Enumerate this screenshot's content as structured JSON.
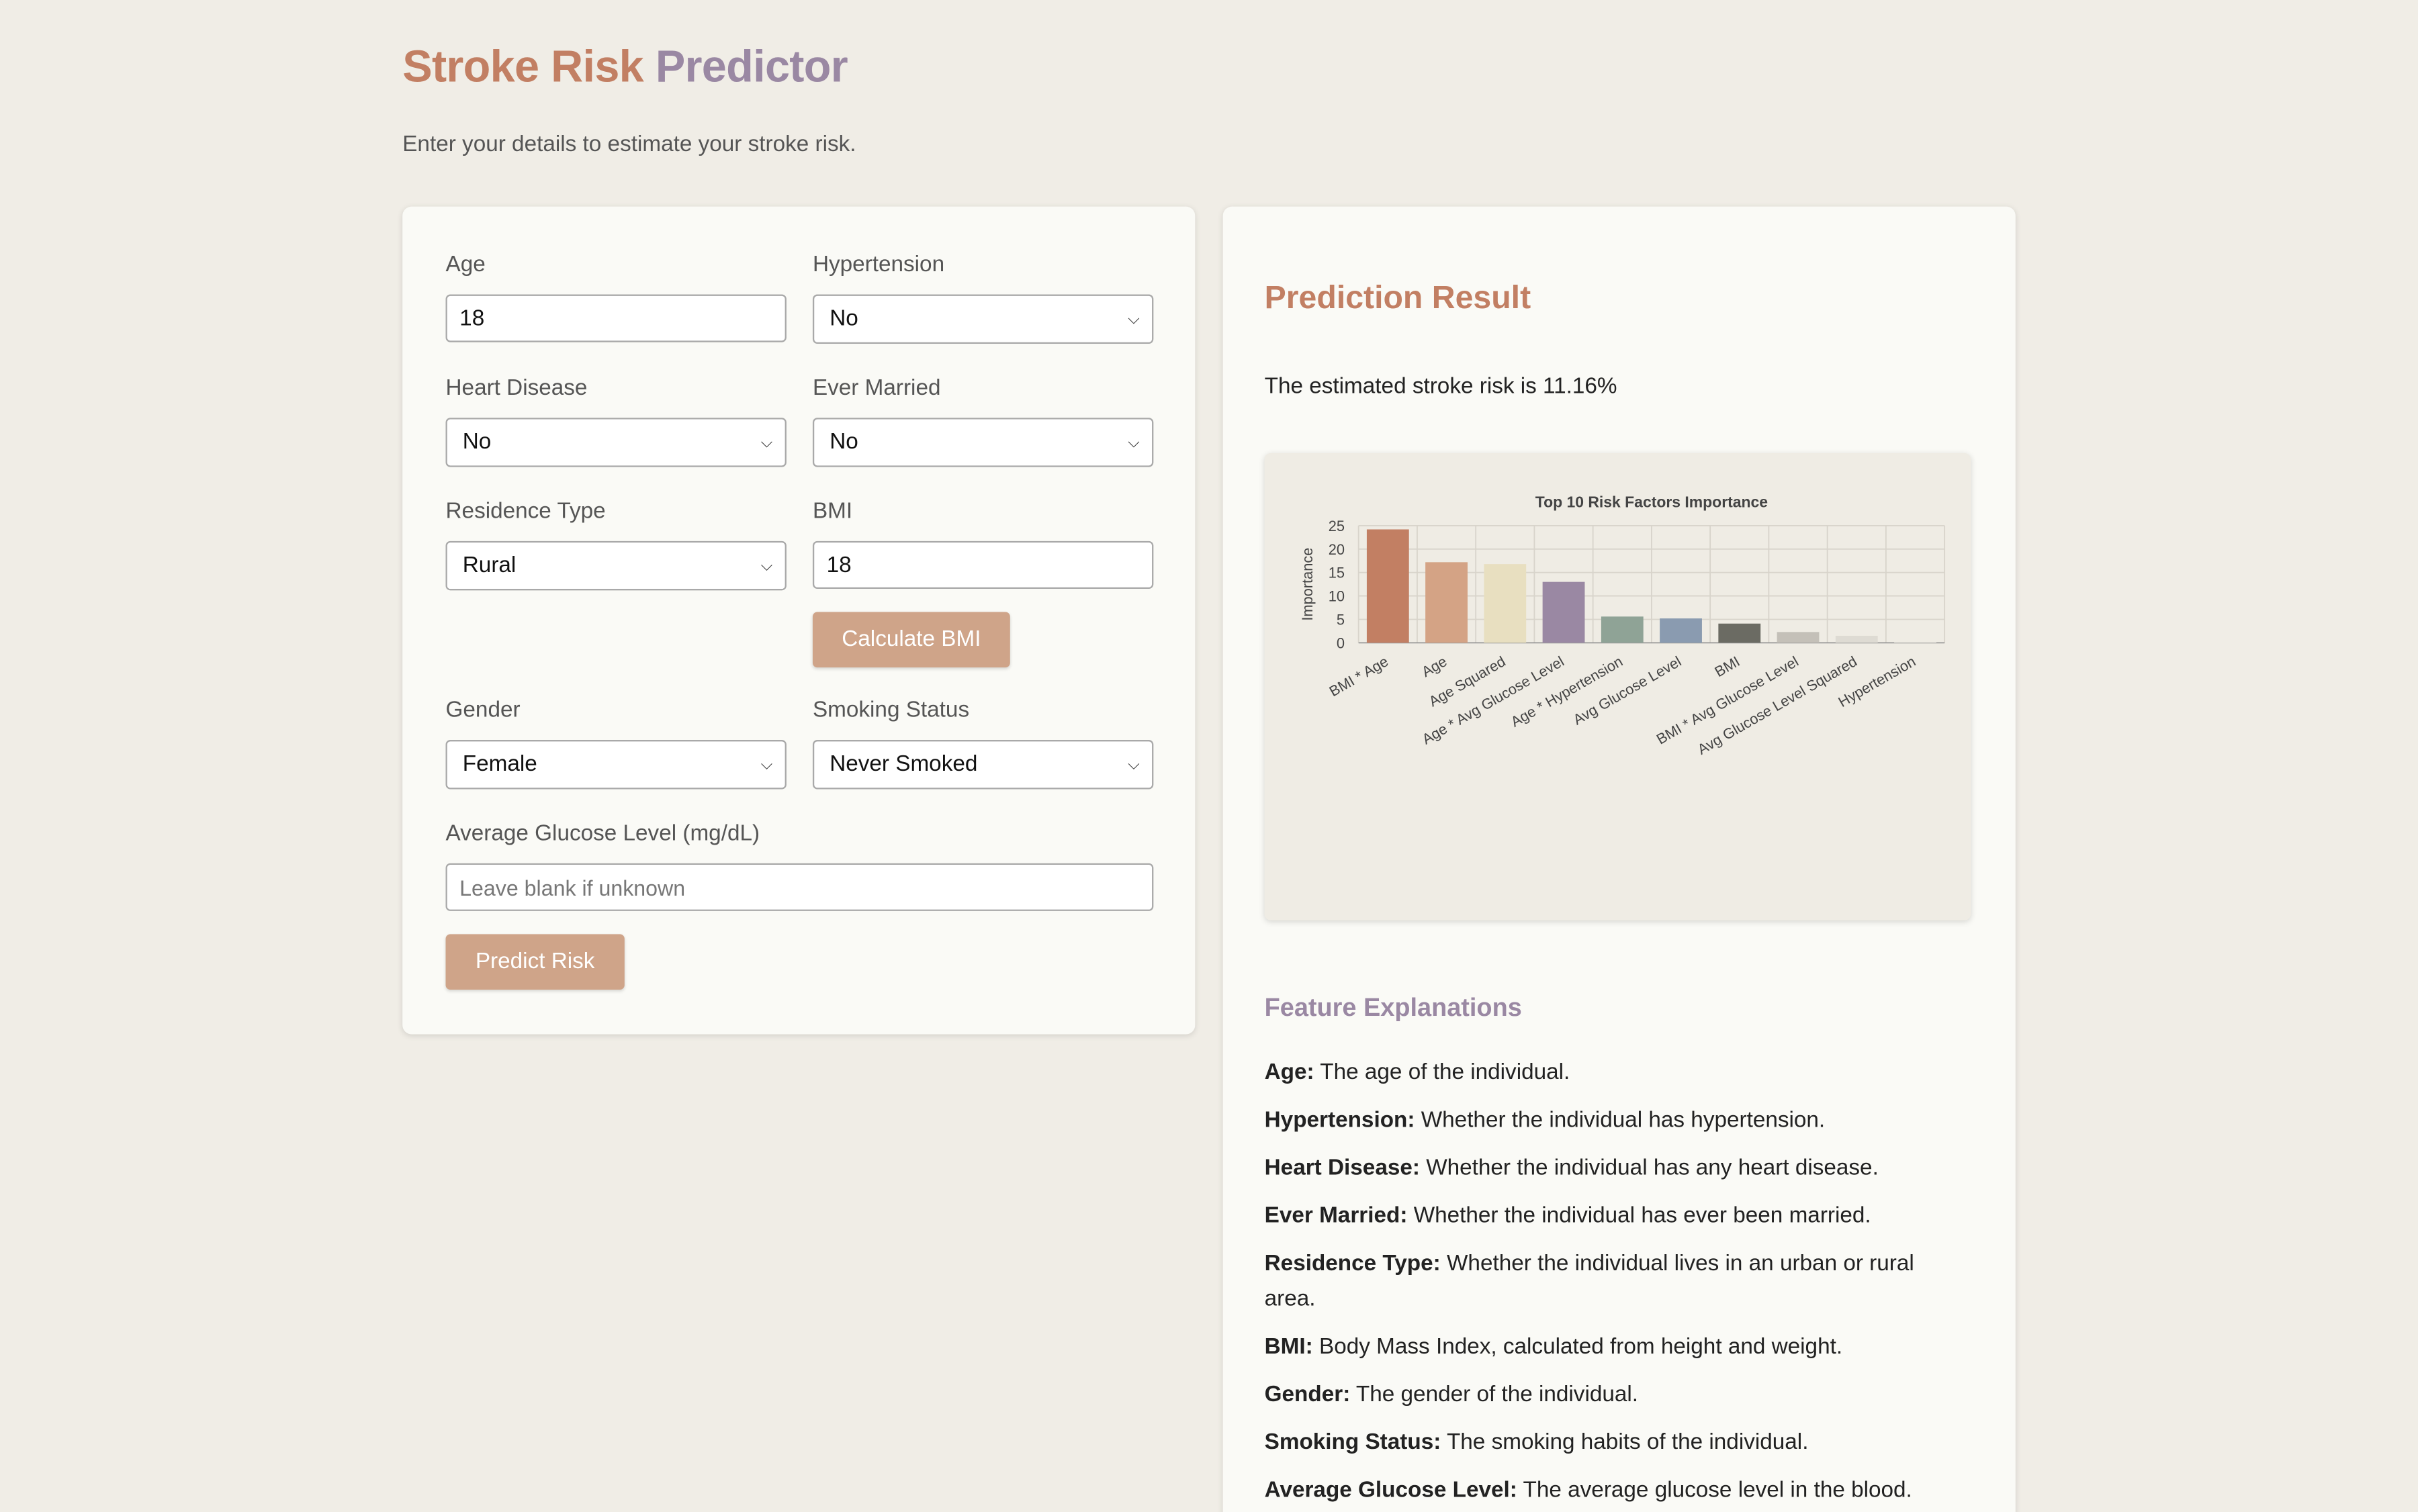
{
  "header": {
    "title_part1": "Stroke Risk",
    "title_part2": "Predictor",
    "subtitle": "Enter your details to estimate your stroke risk."
  },
  "form": {
    "age": {
      "label": "Age",
      "value": "18"
    },
    "hypertension": {
      "label": "Hypertension",
      "value": "No"
    },
    "heart_disease": {
      "label": "Heart Disease",
      "value": "No"
    },
    "ever_married": {
      "label": "Ever Married",
      "value": "No"
    },
    "residence_type": {
      "label": "Residence Type",
      "value": "Rural"
    },
    "bmi": {
      "label": "BMI",
      "value": "18"
    },
    "calculate_bmi_label": "Calculate BMI",
    "gender": {
      "label": "Gender",
      "value": "Female"
    },
    "smoking_status": {
      "label": "Smoking Status",
      "value": "Never Smoked"
    },
    "glucose": {
      "label": "Average Glucose Level (mg/dL)",
      "placeholder": "Leave blank if unknown"
    },
    "predict_label": "Predict Risk"
  },
  "result": {
    "title": "Prediction Result",
    "text": "The estimated stroke risk is 11.16%"
  },
  "chart_data": {
    "type": "bar",
    "title": "Top 10 Risk Factors Importance",
    "xlabel": "",
    "ylabel": "Importance",
    "ylim": [
      0,
      25
    ],
    "yticks": [
      0,
      5,
      10,
      15,
      20,
      25
    ],
    "grid": true,
    "categories": [
      "BMI * Age",
      "Age",
      "Age Squared",
      "Age * Avg Glucose Level",
      "Age * Hypertension",
      "Avg Glucose Level",
      "BMI",
      "BMI * Avg Glucose Level",
      "Avg Glucose Level Squared",
      "Hypertension"
    ],
    "values": [
      24.2,
      17.2,
      16.8,
      13.0,
      5.6,
      5.2,
      4.1,
      2.3,
      1.5,
      0.2
    ],
    "colors": [
      "#c27f63",
      "#d4a385",
      "#e8dfc0",
      "#9a88a3",
      "#8fa396",
      "#8a9bb0",
      "#6b6b63",
      "#c4c0b8",
      "#dedbd3",
      "#e9e6de"
    ]
  },
  "explanations": {
    "title": "Feature Explanations",
    "items": [
      {
        "term": "Age:",
        "desc": "The age of the individual."
      },
      {
        "term": "Hypertension:",
        "desc": "Whether the individual has hypertension."
      },
      {
        "term": "Heart Disease:",
        "desc": "Whether the individual has any heart disease."
      },
      {
        "term": "Ever Married:",
        "desc": "Whether the individual has ever been married."
      },
      {
        "term": "Residence Type:",
        "desc": "Whether the individual lives in an urban or rural area."
      },
      {
        "term": "BMI:",
        "desc": "Body Mass Index, calculated from height and weight."
      },
      {
        "term": "Gender:",
        "desc": "The gender of the individual."
      },
      {
        "term": "Smoking Status:",
        "desc": "The smoking habits of the individual."
      },
      {
        "term": "Average Glucose Level:",
        "desc": "The average glucose level in the blood."
      }
    ]
  }
}
